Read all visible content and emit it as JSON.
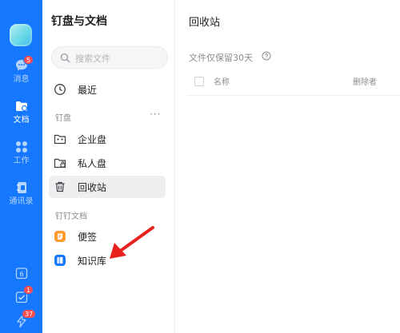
{
  "rail": {
    "items": [
      {
        "label": "消息",
        "icon": "chat-bubble-icon",
        "badge": "5"
      },
      {
        "label": "文档",
        "icon": "docs-folder-icon",
        "active": true
      },
      {
        "label": "工作",
        "icon": "apps-grid-icon"
      },
      {
        "label": "通讯录",
        "icon": "contacts-book-icon"
      }
    ],
    "bottom": [
      {
        "icon": "calendar-icon",
        "text": "6"
      },
      {
        "icon": "todo-check-icon",
        "badge": "1"
      },
      {
        "icon": "ding-lightning-icon",
        "badge": "37"
      }
    ]
  },
  "sidebar": {
    "title": "钉盘与文档",
    "search_placeholder": "搜索文件",
    "recent": "最近",
    "section_drive": "钉盘",
    "more": "···",
    "drive_items": [
      {
        "label": "企业盘",
        "icon": "enterprise-drive-icon"
      },
      {
        "label": "私人盘",
        "icon": "private-drive-icon"
      },
      {
        "label": "回收站",
        "icon": "trash-icon",
        "active": true
      }
    ],
    "section_docs": "钉钉文档",
    "doc_items": [
      {
        "label": "便签",
        "icon": "notes-icon",
        "color": "#ff9a2e"
      },
      {
        "label": "知识库",
        "icon": "knowledge-base-icon",
        "color": "#1677ff"
      }
    ]
  },
  "main": {
    "title": "回收站",
    "retention_note": "文件仅保留30天",
    "columns": {
      "name": "名称",
      "deleted_by": "删除者"
    }
  },
  "colors": {
    "rail": "#1677ff",
    "annotation_arrow": "#e8231f",
    "badge": "#ff4d4f"
  }
}
